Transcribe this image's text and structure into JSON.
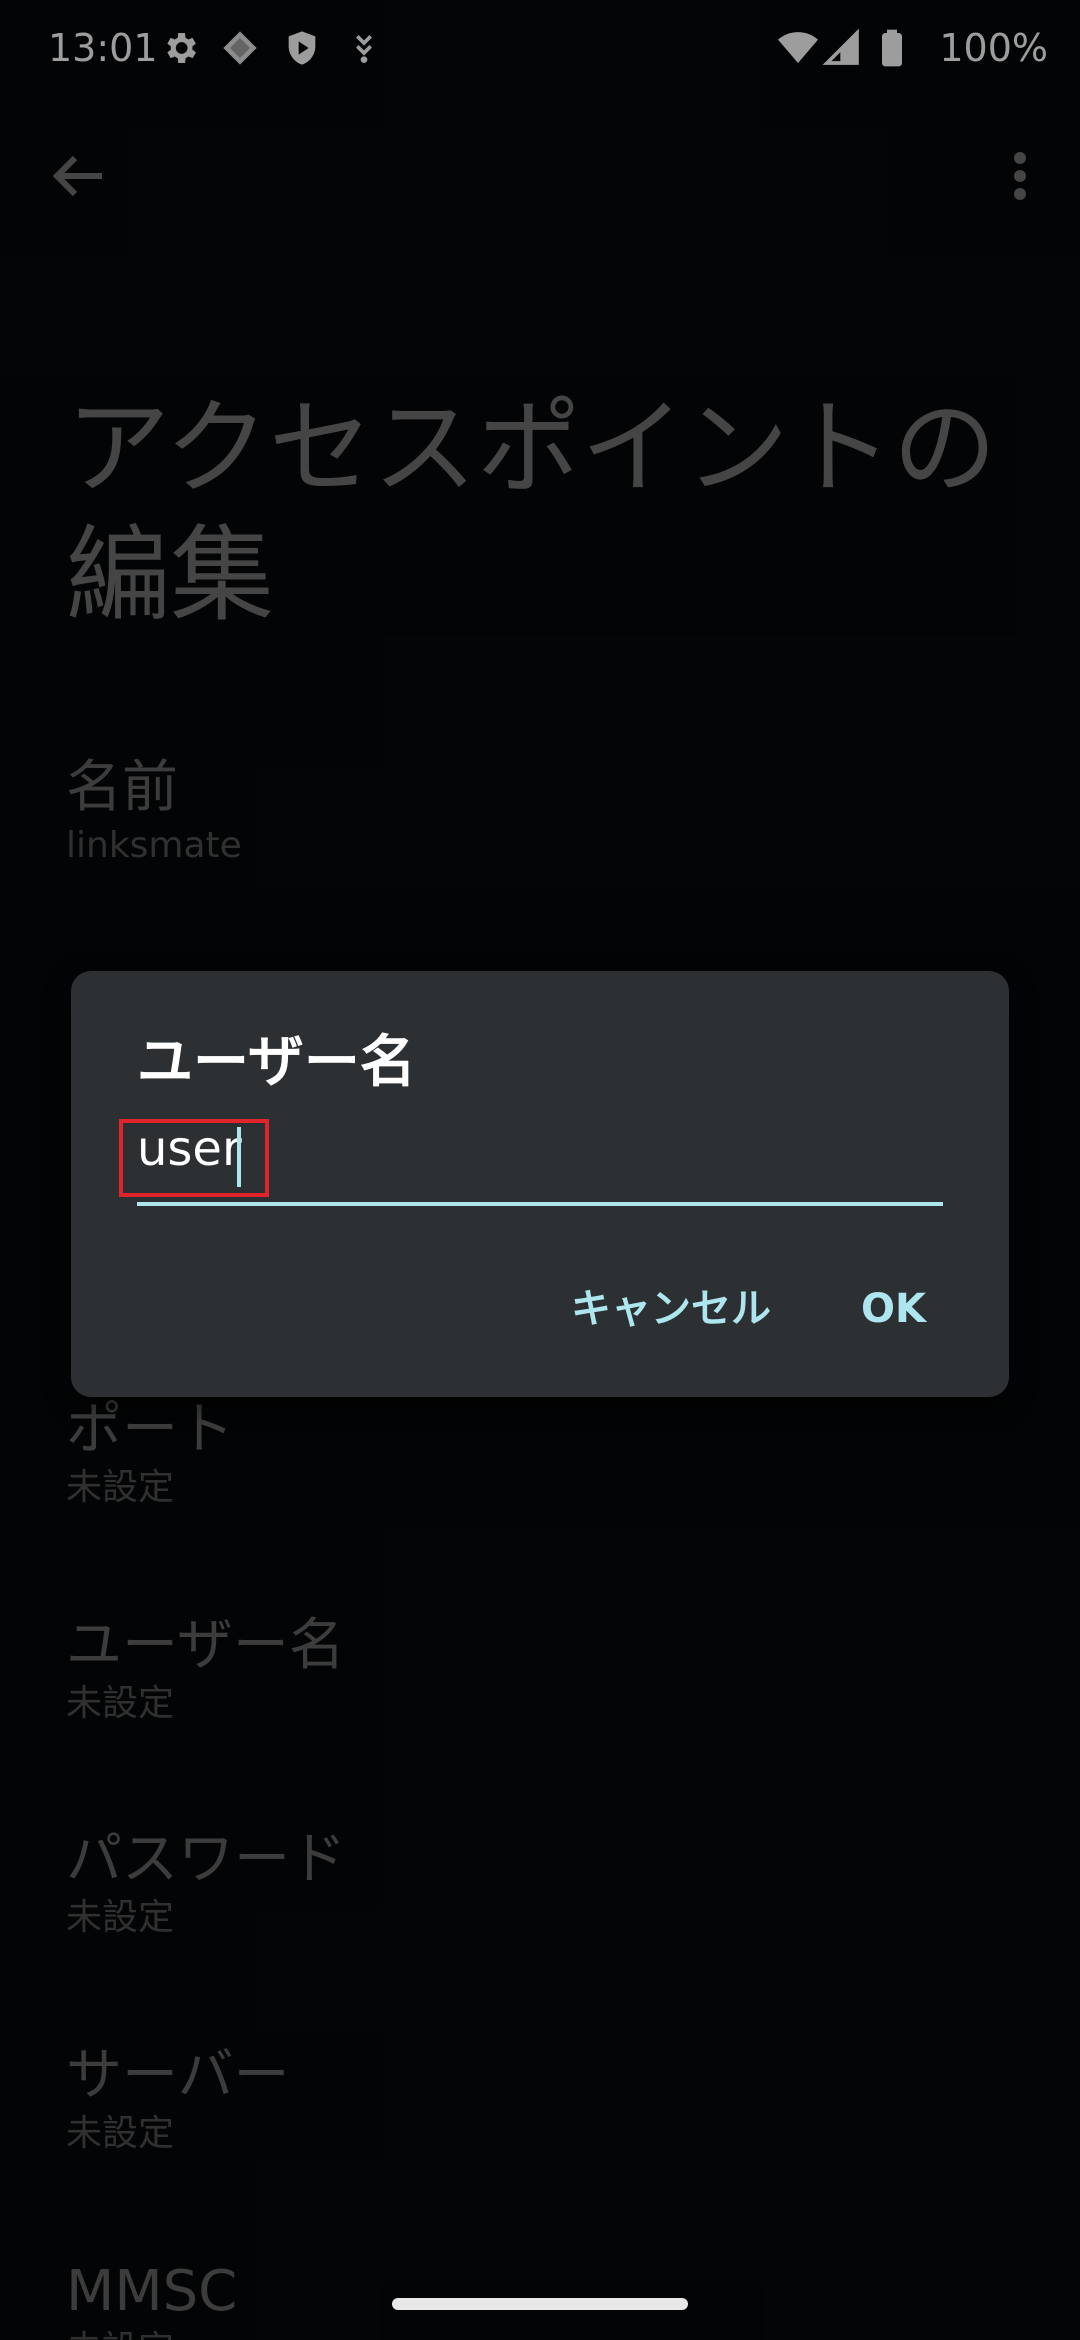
{
  "status_bar": {
    "time": "13:01",
    "left_icons": [
      "gear-icon",
      "diamond-app-icon",
      "shield-play-icon",
      "download-arrow-icon"
    ],
    "right_icons": [
      "wifi-icon",
      "cell-signal-icon",
      "battery-icon"
    ],
    "battery": "100%"
  },
  "app_bar": {
    "back_icon": "arrow-left-icon",
    "menu_icon": "more-vertical-icon"
  },
  "page": {
    "title": "アクセスポイントの編集"
  },
  "preferences": [
    {
      "title": "名前",
      "summary": "linksmate"
    },
    {
      "title": "ポート",
      "summary": "未設定"
    },
    {
      "title": "ユーザー名",
      "summary": "未設定"
    },
    {
      "title": "パスワード",
      "summary": "未設定"
    },
    {
      "title": "サーバー",
      "summary": "未設定"
    },
    {
      "title": "MMSC",
      "summary": "未設定"
    }
  ],
  "dialog": {
    "title": "ユーザー名",
    "input_value": "user",
    "cancel_label": "キャンセル",
    "ok_label": "OK"
  },
  "colors": {
    "background": "#060709",
    "dialog_background": "#2c3033",
    "accent": "#aee6ef",
    "highlight": "#e0242b"
  }
}
